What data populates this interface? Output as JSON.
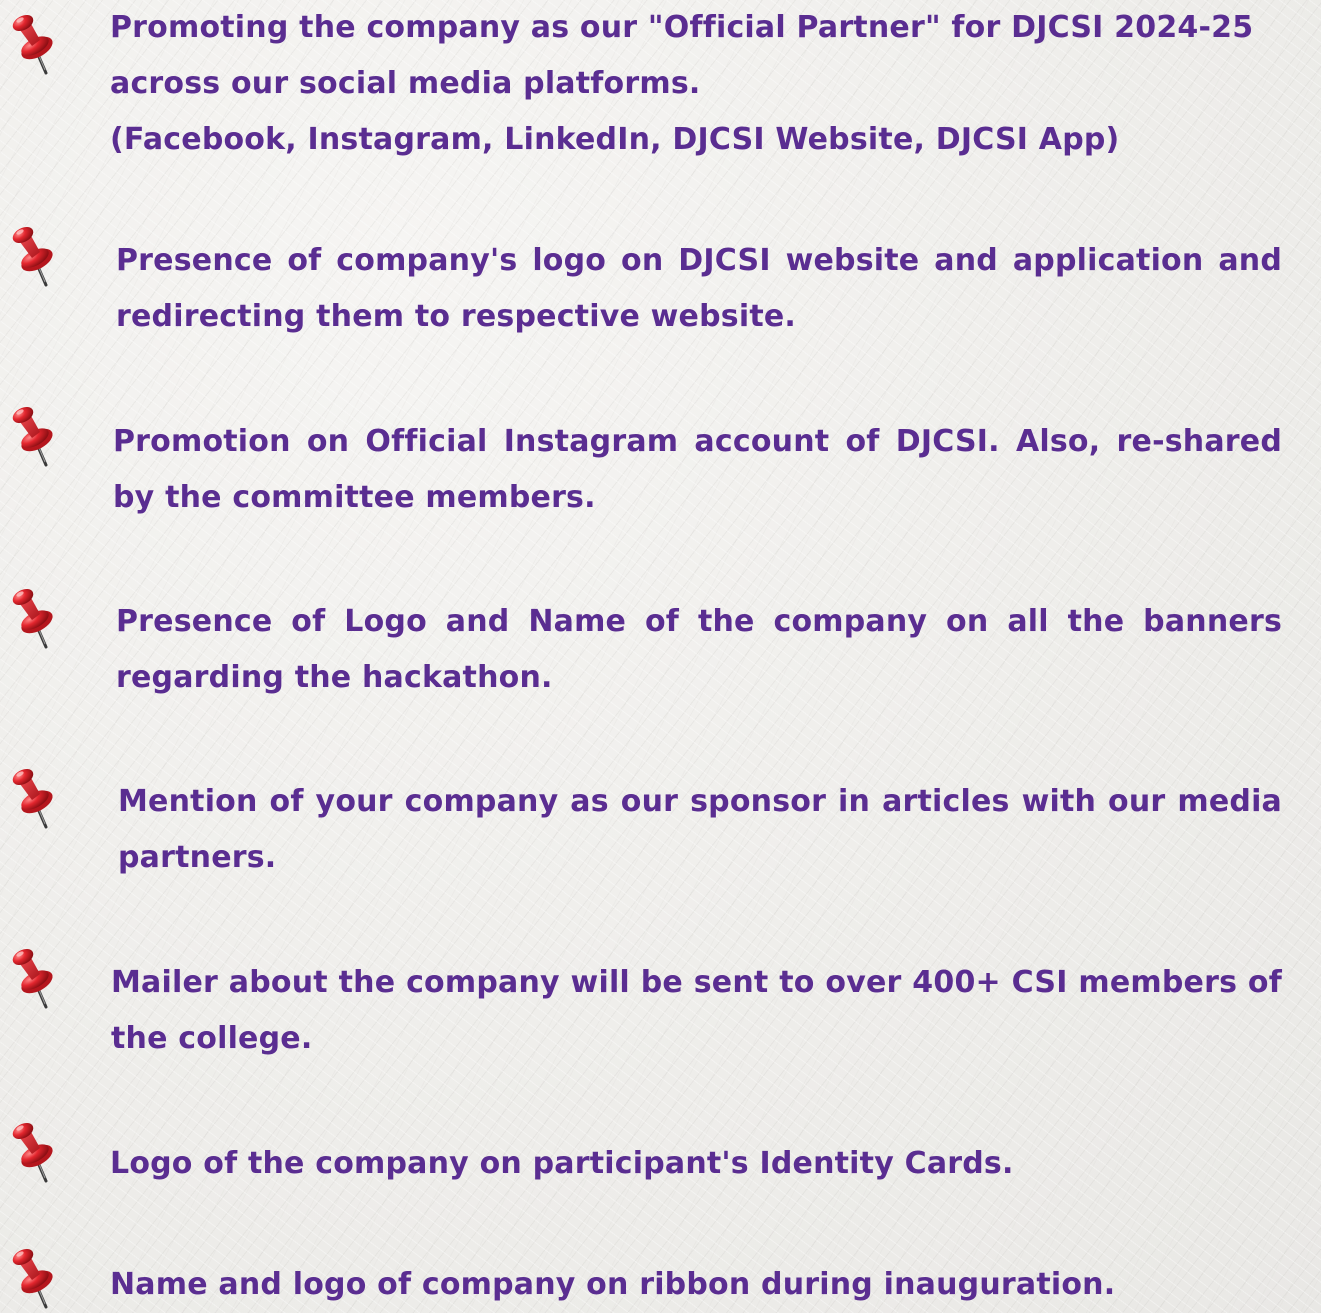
{
  "benefits": [
    {
      "icon": "pushpin-icon",
      "text": "Promoting the company as our \"Official Partner\" for DJCSI 2024-25 across our social media platforms.\n(Facebook, Instagram, LinkedIn, DJCSI Website, DJCSI App)"
    },
    {
      "icon": "pushpin-icon",
      "text": "Presence of company's logo on DJCSI website and application and redirecting them to respective website."
    },
    {
      "icon": "pushpin-icon",
      "text": "Promotion on Official Instagram account of DJCSI. Also, re-shared by the committee members."
    },
    {
      "icon": "pushpin-icon",
      "text": "Presence of Logo and Name of the company on all the banners regarding the hackathon."
    },
    {
      "icon": "pushpin-icon",
      "text": "Mention of your company as our sponsor in articles with our media partners."
    },
    {
      "icon": "pushpin-icon",
      "text": "Mailer about the company will be sent to over 400+ CSI members of the college."
    },
    {
      "icon": "pushpin-icon",
      "text": "Logo of the company on participant's Identity Cards."
    },
    {
      "icon": "pushpin-icon",
      "text": "Name and logo of company on ribbon during inauguration."
    }
  ],
  "colors": {
    "text": "#5a2d91",
    "pin": "#d8242c",
    "background": "#f1f0ee"
  }
}
